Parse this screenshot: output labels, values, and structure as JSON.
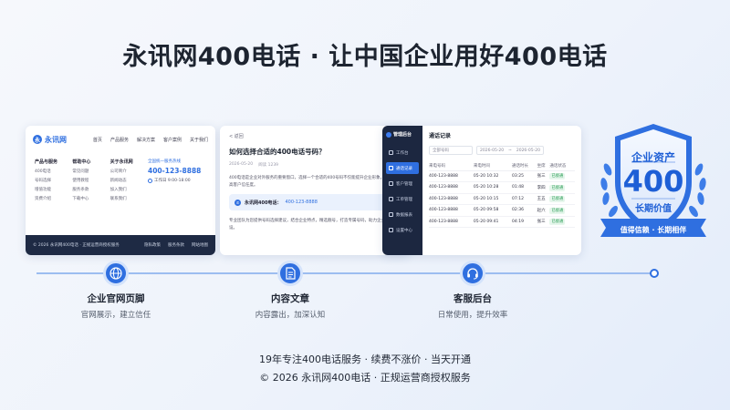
{
  "title": "永讯网400电话 · 让中国企业用好400电话",
  "card_website": {
    "logo_mark": "永",
    "logo_text": "永讯网",
    "nav": [
      "首页",
      "产品服务",
      "解决方案",
      "客户案例",
      "关于我们"
    ],
    "columns": [
      {
        "heading": "产品与服务",
        "items": [
          "400电话",
          "号码选择",
          "增值功能",
          "资费介绍"
        ]
      },
      {
        "heading": "帮助中心",
        "items": [
          "常见问题",
          "使用教程",
          "服务条款",
          "下载中心"
        ]
      },
      {
        "heading": "关于永讯网",
        "items": [
          "公司简介",
          "新闻动态",
          "加入我们",
          "联系我们"
        ]
      }
    ],
    "contact_label": "全国统一服务热线",
    "phone": "400-123-8888",
    "hours": "工作日 9:00-18:00",
    "copyright": "© 2026 永讯网400电话 · 正规运营商授权服务",
    "footer_links": [
      "隐私政策",
      "服务条款",
      "网站地图"
    ]
  },
  "card_article": {
    "back": "< 返回",
    "title": "如何选择合适的400电话号码？",
    "date": "2026-05-20",
    "views": "阅读 1239",
    "para1": "400电话是企业对外服务的重要窗口，选择一个合适的400号码不仅能提升企业形象，还能提高客户信任度。",
    "phone_label": "永讯网400电话：",
    "phone_number": "400-123-8888",
    "para2": "专业团队为您提供号码选择建议，结合企业特点，精选靓号，打造专属号码，助力企业品牌建设。"
  },
  "card_dashboard": {
    "brand": "管理后台",
    "sidebar": [
      "工作台",
      "通话记录",
      "客户管理",
      "工单管理",
      "数据报表",
      "设置中心"
    ],
    "active_index": 1,
    "page_title": "通话记录",
    "filter_select": "全部号码",
    "date_from": "2026-05-20",
    "date_to": "2026-05-20",
    "columns": [
      "来电号码",
      "来电时间",
      "通话时长",
      "坐席",
      "通话状态"
    ],
    "rows": [
      [
        "400-123-8888",
        "05-20 10:32",
        "03:25",
        "张三",
        "已接通"
      ],
      [
        "400-123-8888",
        "05-20 10:28",
        "01:48",
        "李四",
        "已接通"
      ],
      [
        "400-123-8888",
        "05-20 10:15",
        "07:12",
        "王五",
        "已接通"
      ],
      [
        "400-123-8888",
        "05-20 09:58",
        "02:36",
        "赵六",
        "已接通"
      ],
      [
        "400-123-8888",
        "05-20 09:41",
        "04:19",
        "张三",
        "已接通"
      ]
    ]
  },
  "badge": {
    "line1": "企业资产",
    "line2": "400",
    "line3": "长期价值",
    "ribbon": "值得信赖 · 长期相伴",
    "color": "#1e5fd6"
  },
  "timeline": [
    {
      "heading": "企业官网页脚",
      "sub": "官网展示，建立信任",
      "icon": "globe-icon"
    },
    {
      "heading": "内容文章",
      "sub": "内容露出，加深认知",
      "icon": "document-icon"
    },
    {
      "heading": "客服后台",
      "sub": "日常使用，提升效率",
      "icon": "headset-icon"
    }
  ],
  "footer_line1": "19年专注400电话服务 · 续费不涨价 · 当天开通",
  "footer_line2": "© 2026 永讯网400电话 · 正规运营商授权服务",
  "accent_color": "#2f6fe0"
}
